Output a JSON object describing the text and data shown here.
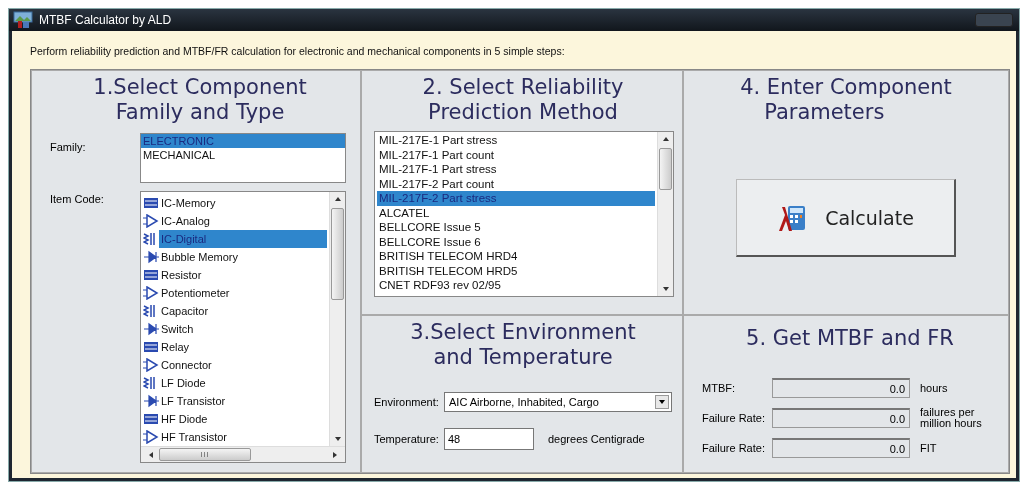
{
  "window": {
    "title": "MTBF Calculator by ALD"
  },
  "instruction": "Perform reliability prediction and MTBF/FR calculation for electronic and mechanical components in 5 simple steps:",
  "step1": {
    "heading_lines": [
      "1.Select Component",
      "Family and Type"
    ],
    "family_label": "Family:",
    "families": [
      {
        "label": "ELECTRONIC",
        "selected": true
      },
      {
        "label": "MECHANICAL",
        "selected": false
      }
    ],
    "item_code_label": "Item Code:",
    "item_codes": [
      {
        "label": "IC-Memory",
        "selected": false
      },
      {
        "label": "IC-Analog",
        "selected": false
      },
      {
        "label": "IC-Digital",
        "selected": true
      },
      {
        "label": "Bubble Memory",
        "selected": false
      },
      {
        "label": "Resistor",
        "selected": false
      },
      {
        "label": "Potentiometer",
        "selected": false
      },
      {
        "label": "Capacitor",
        "selected": false
      },
      {
        "label": "Switch",
        "selected": false
      },
      {
        "label": "Relay",
        "selected": false
      },
      {
        "label": "Connector",
        "selected": false
      },
      {
        "label": "LF Diode",
        "selected": false
      },
      {
        "label": "LF Transistor",
        "selected": false
      },
      {
        "label": "HF Diode",
        "selected": false
      },
      {
        "label": "HF Transistor",
        "selected": false
      }
    ],
    "scroll_glyph": "III"
  },
  "step2": {
    "heading_lines": [
      "2. Select Reliability",
      "Prediction Method"
    ],
    "methods": [
      {
        "label": "MIL-217E-1 Part stress",
        "selected": false
      },
      {
        "label": "MIL-217F-1 Part count",
        "selected": false
      },
      {
        "label": "MIL-217F-1 Part stress",
        "selected": false
      },
      {
        "label": "MIL-217F-2 Part count",
        "selected": false
      },
      {
        "label": "MIL-217F-2 Part stress",
        "selected": true
      },
      {
        "label": "ALCATEL",
        "selected": false
      },
      {
        "label": "BELLCORE Issue 5",
        "selected": false
      },
      {
        "label": "BELLCORE Issue 6",
        "selected": false
      },
      {
        "label": "BRITISH TELECOM HRD4",
        "selected": false
      },
      {
        "label": "BRITISH TELECOM HRD5",
        "selected": false
      },
      {
        "label": "CNET RDF93 rev 02/95",
        "selected": false
      }
    ]
  },
  "step3": {
    "heading_lines": [
      "3.Select Environment",
      "and Temperature"
    ],
    "environment_label": "Environment:",
    "environment": "AIC Airborne, Inhabited, Cargo",
    "temperature_label": "Temperature:",
    "temperature": "48",
    "temperature_unit": "degrees Centigrade"
  },
  "step4": {
    "heading_lines": [
      "4. Enter Component",
      "Parameters"
    ],
    "button": "Calculate"
  },
  "step5": {
    "heading": "5. Get MTBF and FR",
    "results": [
      {
        "label": "MTBF:",
        "value": "0.0",
        "unit": "hours"
      },
      {
        "label": "Failure Rate:",
        "value": "0.0",
        "unit": "failures per million hours"
      },
      {
        "label": "Failure Rate:",
        "value": "0.0",
        "unit": "FIT"
      }
    ]
  }
}
